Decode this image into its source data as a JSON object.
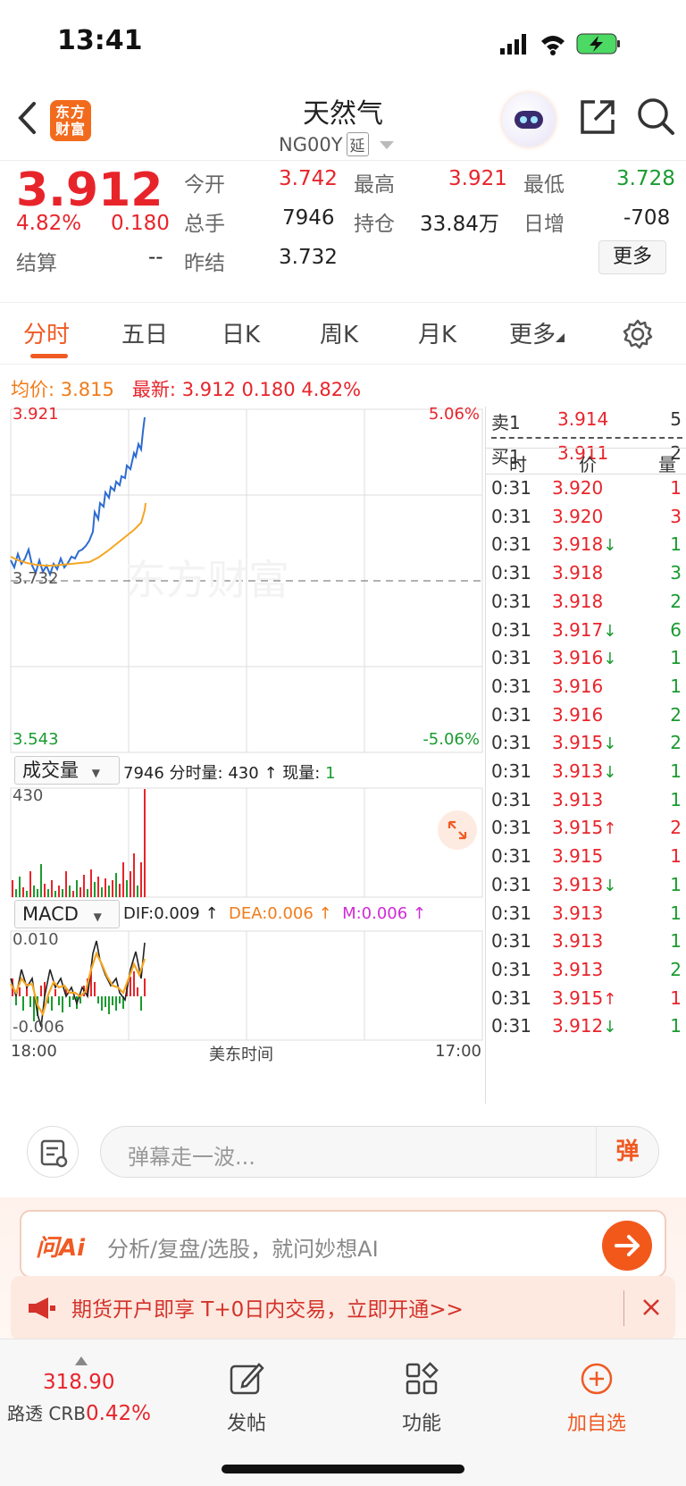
{
  "status_bar": {
    "time": "13:41"
  },
  "header": {
    "logo_line1": "东方",
    "logo_line2": "财富",
    "title": "天然气",
    "code": "NG00Y",
    "delay_badge": "延"
  },
  "quote": {
    "last_price": "3.912",
    "change_pct": "4.82%",
    "change": "0.180",
    "open_label": "今开",
    "open": "3.742",
    "high_label": "最高",
    "high": "3.921",
    "low_label": "最低",
    "low": "3.728",
    "volume_label": "总手",
    "volume": "7946",
    "oi_label": "持仓",
    "oi": "33.84万",
    "daily_inc_label": "日增",
    "daily_inc": "-708",
    "settle_label": "结算",
    "settle": "--",
    "prev_settle_label": "昨结",
    "prev_settle": "3.732",
    "more_button": "更多"
  },
  "tabs": [
    "分时",
    "五日",
    "日K",
    "周K",
    "月K",
    "更多"
  ],
  "summary": {
    "avg_label": "均价:",
    "avg": "3.815",
    "latest_label": "最新:",
    "latest": "3.912",
    "change": "0.180",
    "change_pct": "4.82%"
  },
  "chart": {
    "y_top": "3.921",
    "y_mid": "3.732",
    "y_bottom": "3.543",
    "pct_top": "5.06%",
    "pct_bottom": "-5.06%",
    "watermark": "东方财富",
    "volume_selector": "成交量",
    "volume_info_total": "7946",
    "volume_info_label": "分时量:",
    "volume_info_value": "430",
    "volume_info_arrow": "↑",
    "volume_now_label": "现量:",
    "volume_now_value": "1",
    "volume_max": "430",
    "macd_selector": "MACD",
    "dif": "DIF:0.009 ↑",
    "dea": "DEA:0.006 ↑",
    "m": "M:0.006 ↑",
    "macd_top": "0.010",
    "macd_bottom": "-0.006",
    "x_start": "18:00",
    "x_mid": "美东时间",
    "x_end": "17:00"
  },
  "order_book": {
    "ask_label": "卖1",
    "ask_price": "3.914",
    "ask_vol": "5",
    "bid_label": "买1",
    "bid_price": "3.911",
    "bid_vol": "2",
    "col_time": "时",
    "col_price": "价",
    "col_vol": "量"
  },
  "trades": [
    {
      "t": "0:31",
      "p": "3.920",
      "arrow": "",
      "v": "1",
      "vc": "red"
    },
    {
      "t": "0:31",
      "p": "3.920",
      "arrow": "",
      "v": "3",
      "vc": "red"
    },
    {
      "t": "0:31",
      "p": "3.918",
      "arrow": "↓",
      "v": "1",
      "vc": "green"
    },
    {
      "t": "0:31",
      "p": "3.918",
      "arrow": "",
      "v": "3",
      "vc": "green"
    },
    {
      "t": "0:31",
      "p": "3.918",
      "arrow": "",
      "v": "2",
      "vc": "green"
    },
    {
      "t": "0:31",
      "p": "3.917",
      "arrow": "↓",
      "v": "6",
      "vc": "green"
    },
    {
      "t": "0:31",
      "p": "3.916",
      "arrow": "↓",
      "v": "1",
      "vc": "green"
    },
    {
      "t": "0:31",
      "p": "3.916",
      "arrow": "",
      "v": "1",
      "vc": "green"
    },
    {
      "t": "0:31",
      "p": "3.916",
      "arrow": "",
      "v": "2",
      "vc": "green"
    },
    {
      "t": "0:31",
      "p": "3.915",
      "arrow": "↓",
      "v": "2",
      "vc": "green"
    },
    {
      "t": "0:31",
      "p": "3.913",
      "arrow": "↓",
      "v": "1",
      "vc": "green"
    },
    {
      "t": "0:31",
      "p": "3.913",
      "arrow": "",
      "v": "1",
      "vc": "green"
    },
    {
      "t": "0:31",
      "p": "3.915",
      "arrow": "↑",
      "v": "2",
      "vc": "red"
    },
    {
      "t": "0:31",
      "p": "3.915",
      "arrow": "",
      "v": "1",
      "vc": "red"
    },
    {
      "t": "0:31",
      "p": "3.913",
      "arrow": "↓",
      "v": "1",
      "vc": "green"
    },
    {
      "t": "0:31",
      "p": "3.913",
      "arrow": "",
      "v": "1",
      "vc": "green"
    },
    {
      "t": "0:31",
      "p": "3.913",
      "arrow": "",
      "v": "1",
      "vc": "green"
    },
    {
      "t": "0:31",
      "p": "3.913",
      "arrow": "",
      "v": "2",
      "vc": "green"
    },
    {
      "t": "0:31",
      "p": "3.915",
      "arrow": "↑",
      "v": "1",
      "vc": "red"
    },
    {
      "t": "0:31",
      "p": "3.912",
      "arrow": "↓",
      "v": "1",
      "vc": "green"
    }
  ],
  "danmu": {
    "placeholder": "弹幕走一波...",
    "button": "弹"
  },
  "ai": {
    "logo": "问Ai",
    "placeholder": "分析/复盘/选股，就问妙想AI"
  },
  "promo": {
    "text": "期货开户即享 T+0日内交易，立即开通>>"
  },
  "bottom_nav": {
    "index_value": "318.90",
    "index_name": "路透 CRB",
    "index_change": "0.42%",
    "post": "发帖",
    "function": "功能",
    "add_watch": "加自选"
  },
  "colors": {
    "up": "#e8242b",
    "down": "#1a9b30",
    "accent": "#f05a23",
    "price_line": "#2d6bd1",
    "avg_line": "#f5a623"
  }
}
